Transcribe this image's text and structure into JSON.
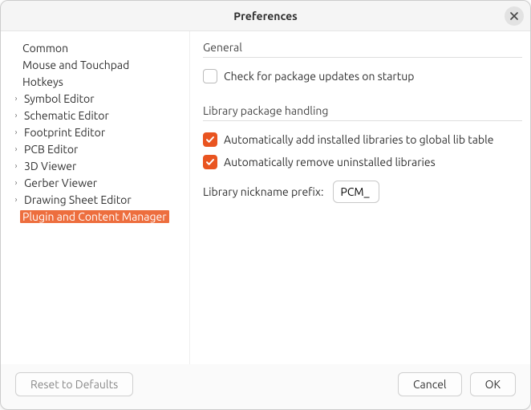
{
  "window": {
    "title": "Preferences"
  },
  "sidebar": {
    "items": [
      {
        "label": "Common",
        "expandable": false
      },
      {
        "label": "Mouse and Touchpad",
        "expandable": false
      },
      {
        "label": "Hotkeys",
        "expandable": false
      },
      {
        "label": "Symbol Editor",
        "expandable": true
      },
      {
        "label": "Schematic Editor",
        "expandable": true
      },
      {
        "label": "Footprint Editor",
        "expandable": true
      },
      {
        "label": "PCB Editor",
        "expandable": true
      },
      {
        "label": "3D Viewer",
        "expandable": true
      },
      {
        "label": "Gerber Viewer",
        "expandable": true
      },
      {
        "label": "Drawing Sheet Editor",
        "expandable": true
      },
      {
        "label": "Plugin and Content Manager",
        "expandable": false,
        "selected": true
      }
    ]
  },
  "main": {
    "general": {
      "title": "General",
      "check_updates": {
        "label": "Check for package updates on startup",
        "checked": false
      }
    },
    "library": {
      "title": "Library package handling",
      "auto_add": {
        "label": "Automatically add installed libraries to global lib table",
        "checked": true
      },
      "auto_remove": {
        "label": "Automatically remove uninstalled libraries",
        "checked": true
      },
      "prefix_label": "Library nickname prefix:",
      "prefix_value": "PCM_"
    }
  },
  "footer": {
    "reset": "Reset to Defaults",
    "cancel": "Cancel",
    "ok": "OK"
  }
}
